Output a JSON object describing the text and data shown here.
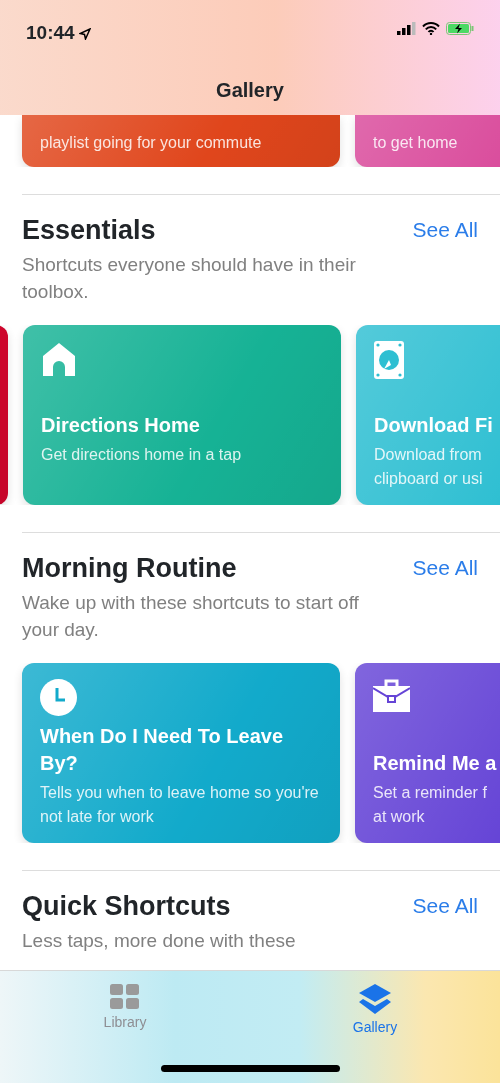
{
  "status_bar": {
    "time": "10:44"
  },
  "header": {
    "title": "Gallery"
  },
  "top_cards": [
    {
      "description": "playlist going for your commute",
      "color": "#e0461c"
    },
    {
      "description": "to get home",
      "color": "#d9489a"
    }
  ],
  "sections": [
    {
      "title": "Essentials",
      "see_all": "See All",
      "description": "Shortcuts everyone should have in their toolbox.",
      "leading_card": {
        "color": "#d2052c"
      },
      "cards": [
        {
          "title": "Directions Home",
          "description": "Get directions home in a tap",
          "color": "#16b295"
        },
        {
          "title": "Download Fi",
          "description": "Download from\nclipboard or usi",
          "color": "#2ebfd2"
        }
      ]
    },
    {
      "title": "Morning Routine",
      "see_all": "See All",
      "description": "Wake up with these shortcuts to start off your day.",
      "cards": [
        {
          "title": "When Do I Need To Leave By?",
          "description": "Tells you when to leave home so you're not late for work",
          "color": "#12aacb"
        },
        {
          "title": "Remind Me a",
          "description": "Set a reminder f\nat work",
          "color": "#6544d6"
        }
      ]
    },
    {
      "title": "Quick Shortcuts",
      "see_all": "See All",
      "description": "Less taps, more done with these"
    }
  ],
  "tab_bar": [
    {
      "label": "Library",
      "selected": false
    },
    {
      "label": "Gallery",
      "selected": true
    }
  ]
}
